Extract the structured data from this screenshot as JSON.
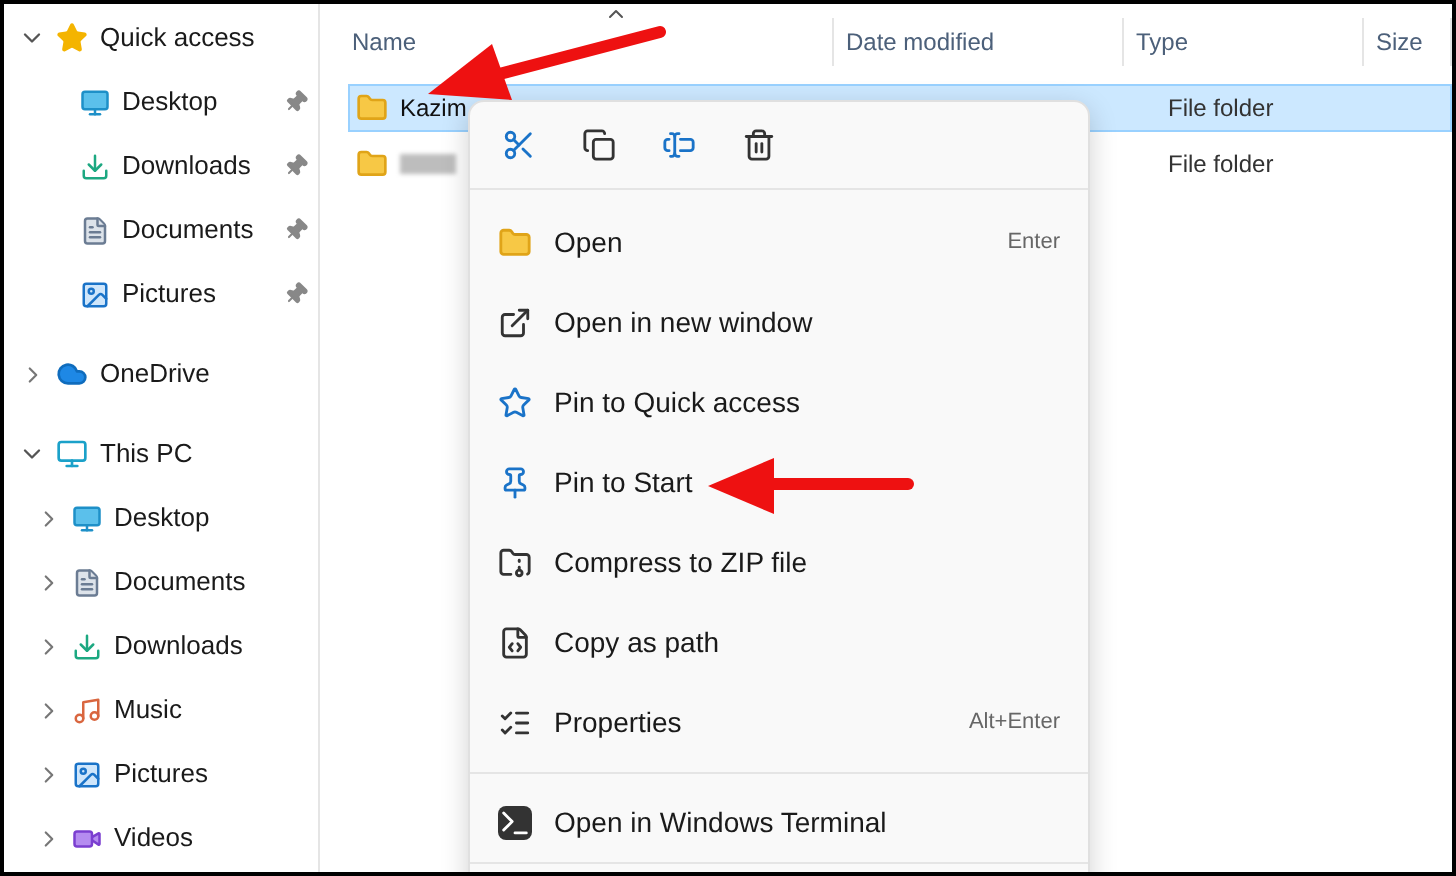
{
  "sidebar": {
    "groups": [
      {
        "label": "Quick access",
        "kind": "quick",
        "expanded": true,
        "items": [
          {
            "label": "Desktop",
            "kind": "desktop",
            "pinned": true
          },
          {
            "label": "Downloads",
            "kind": "downloads",
            "pinned": true
          },
          {
            "label": "Documents",
            "kind": "documents",
            "pinned": true
          },
          {
            "label": "Pictures",
            "kind": "pictures",
            "pinned": true
          }
        ]
      },
      {
        "label": "OneDrive",
        "kind": "cloud",
        "expanded": false
      },
      {
        "label": "This PC",
        "kind": "pc",
        "expanded": true,
        "items": [
          {
            "label": "Desktop",
            "kind": "desktop",
            "pinned": false
          },
          {
            "label": "Documents",
            "kind": "documents",
            "pinned": false
          },
          {
            "label": "Downloads",
            "kind": "downloads",
            "pinned": false
          },
          {
            "label": "Music",
            "kind": "music",
            "pinned": false
          },
          {
            "label": "Pictures",
            "kind": "pictures",
            "pinned": false
          },
          {
            "label": "Videos",
            "kind": "videos",
            "pinned": false
          }
        ]
      }
    ]
  },
  "table": {
    "columns": [
      "Name",
      "Date modified",
      "Type",
      "Size"
    ],
    "rows": [
      {
        "name": "Kazim",
        "type": "File folder",
        "selected": true
      },
      {
        "type": "File folder",
        "selected": false
      }
    ]
  },
  "context_menu": {
    "sections": [
      [
        {
          "label": "Open",
          "kind": "open",
          "shortcut": "Enter"
        },
        {
          "label": "Open in new window",
          "kind": "new-window"
        },
        {
          "label": "Pin to Quick access",
          "kind": "star"
        },
        {
          "label": "Pin to Start",
          "kind": "pin"
        },
        {
          "label": "Compress to ZIP file",
          "kind": "zip"
        },
        {
          "label": "Copy as path",
          "kind": "path"
        },
        {
          "label": "Properties",
          "kind": "properties",
          "shortcut": "Alt+Enter"
        }
      ],
      [
        {
          "label": "Open in Windows Terminal",
          "kind": "terminal"
        }
      ]
    ]
  }
}
